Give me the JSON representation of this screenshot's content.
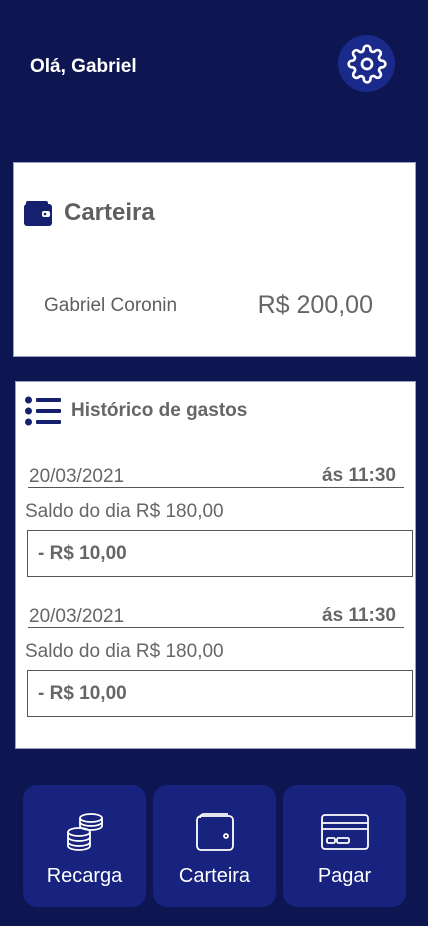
{
  "header": {
    "greeting": "Olá, Gabriel",
    "settings_icon": "gear-icon"
  },
  "wallet": {
    "title": "Carteira",
    "icon": "wallet-icon",
    "owner": "Gabriel Coronin",
    "balance": "R$ 200,00"
  },
  "history": {
    "title": "Histórico de gastos",
    "icon": "list-icon",
    "entries": [
      {
        "date": "20/03/2021",
        "time": "ás 11:30",
        "day_balance": "Saldo do dia R$ 180,00",
        "amount": "- R$ 10,00"
      },
      {
        "date": "20/03/2021",
        "time": "ás 11:30",
        "day_balance": "Saldo do dia R$ 180,00",
        "amount": "- R$ 10,00"
      }
    ]
  },
  "nav": {
    "items": [
      {
        "label": "Recarga",
        "icon": "coins-icon"
      },
      {
        "label": "Carteira",
        "icon": "wallet-icon"
      },
      {
        "label": "Pagar",
        "icon": "credit-card-icon"
      }
    ]
  },
  "colors": {
    "background": "#0d1650",
    "button": "#17237e",
    "accent": "#1a2a8a",
    "card": "#ffffff",
    "text": "#666666"
  }
}
